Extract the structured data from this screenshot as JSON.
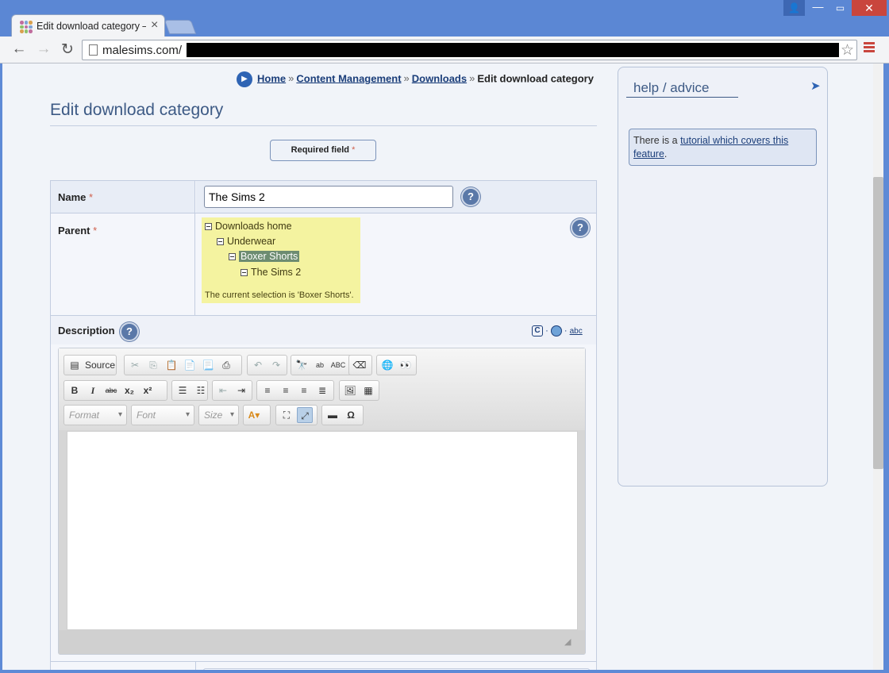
{
  "browser": {
    "tab_title": "Edit download category –",
    "close_glyph": "×",
    "url": "malesims.com/",
    "back_glyph": "←",
    "forward_glyph": "→",
    "reload_glyph": "↻",
    "star_glyph": "☆",
    "min_glyph": "—",
    "max_glyph": "▭",
    "close_win_glyph": "✕",
    "user_glyph": "👤"
  },
  "breadcrumb": {
    "items": [
      "Home",
      "Content Management",
      "Downloads"
    ],
    "separator": "»",
    "current": "Edit download category"
  },
  "page": {
    "title": "Edit download category",
    "required_label": "Required field",
    "required_star": "*"
  },
  "form": {
    "name_label": "Name",
    "name_value": "The Sims 2",
    "parent_label": "Parent",
    "tree": [
      {
        "label": "Downloads home",
        "level": 0,
        "selected": false
      },
      {
        "label": "Underwear",
        "level": 1,
        "selected": false
      },
      {
        "label": "Boxer Shorts",
        "level": 2,
        "selected": true
      },
      {
        "label": "The Sims 2",
        "level": 3,
        "selected": false
      }
    ],
    "tree_status": "The current selection is 'Boxer Shorts'.",
    "description_label": "Description",
    "help_glyph": "?",
    "dot": "·"
  },
  "editor": {
    "source_label": "Source",
    "format_label": "Format",
    "font_label": "Font",
    "size_label": "Size",
    "bold": "B",
    "italic": "I",
    "strike": "abc",
    "sub": "x₂",
    "sup": "x²",
    "omega": "Ω",
    "grip": "◢"
  },
  "side": {
    "heading": "help / advice",
    "arrow_glyph": "➤",
    "advice_prefix": "There is a ",
    "advice_link": "tutorial which covers this feature",
    "advice_suffix": "."
  },
  "colors": {
    "accent": "#2f64b4",
    "title": "#3d5a85",
    "tree_bg": "#f4f3a0",
    "tree_selected": "#6d8c71",
    "required_star": "#d0604c"
  }
}
